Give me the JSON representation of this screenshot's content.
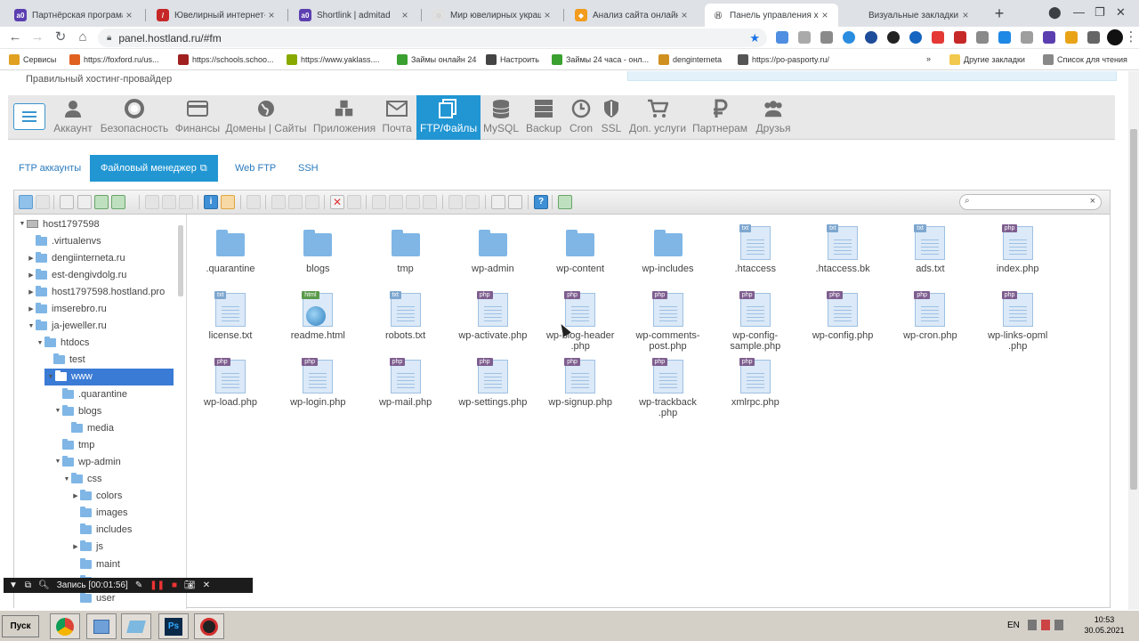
{
  "browser": {
    "tabs": [
      {
        "title": "Партнёрская програма Л",
        "fav_color": "#5b3fb0",
        "fav_text": "a0"
      },
      {
        "title": "Ювелирный интернет-ма",
        "fav_color": "#c62828",
        "fav_text": "/"
      },
      {
        "title": "Shortlink | admitad",
        "fav_color": "#5b3fb0",
        "fav_text": "a0"
      },
      {
        "title": "Мир ювелирных украшен",
        "fav_color": "#e0e0e0",
        "fav_text": "◌"
      },
      {
        "title": "Анализ сайта онлайн | SE",
        "fav_color": "#f29b1c",
        "fav_text": "◆"
      },
      {
        "title": "Панель управления хости",
        "fav_color": "#ffffff",
        "fav_text": "Ⓗ"
      },
      {
        "title": "Визуальные закладки",
        "fav_color": "#dee1e6",
        "fav_text": ""
      }
    ],
    "new_tab": "+",
    "url": "panel.hostland.ru/#fm",
    "bookmarks": [
      {
        "label": "Сервисы",
        "color": "#e0a020"
      },
      {
        "label": "https://foxford.ru/us...",
        "color": "#e06020"
      },
      {
        "label": "https://schools.schoo...",
        "color": "#a02020"
      },
      {
        "label": "https://www.yaklass....",
        "color": "#88aa00"
      },
      {
        "label": "Займы онлайн 24",
        "color": "#3aa030"
      },
      {
        "label": "Настроить",
        "color": "#444444"
      },
      {
        "label": "Займы 24 часа - онл...",
        "color": "#3aa030"
      },
      {
        "label": "denginterneta",
        "color": "#d09020"
      },
      {
        "label": "https://po-pasporty.ru/",
        "color": "#555555"
      }
    ],
    "bookmarks_more": "»",
    "other_bookmarks": "Другие закладки",
    "reading_list": "Список для чтения"
  },
  "page": {
    "tagline": "Правильный хостинг-провайдер",
    "nav": [
      {
        "label": "Аккаунт",
        "icon": "person-icon"
      },
      {
        "label": "Безопасность",
        "icon": "lifebuoy-icon"
      },
      {
        "label": "Финансы",
        "icon": "card-icon"
      },
      {
        "label": "Домены | Сайты",
        "icon": "globe-icon"
      },
      {
        "label": "Приложения",
        "icon": "cubes-icon"
      },
      {
        "label": "Почта",
        "icon": "envelope-icon"
      },
      {
        "label": "FTP/Файлы",
        "icon": "files-icon"
      },
      {
        "label": "MySQL",
        "icon": "database-icon"
      },
      {
        "label": "Backup",
        "icon": "server-icon"
      },
      {
        "label": "Cron",
        "icon": "clock-icon"
      },
      {
        "label": "SSL",
        "icon": "shield-icon"
      },
      {
        "label": "Доп. услуги",
        "icon": "cart-icon"
      },
      {
        "label": "Партнерам",
        "icon": "ruble-icon"
      },
      {
        "label": "Друзья",
        "icon": "users-icon"
      }
    ],
    "active_nav": "FTP/Файлы",
    "subtabs": [
      "FTP аккаунты",
      "Файловый менеджер",
      "Web FTP",
      "SSH"
    ],
    "active_subtab": "Файловый менеджер"
  },
  "filemanager": {
    "tree": [
      {
        "label": "host1797598",
        "level": 0,
        "arrow": "▼",
        "type": "drive"
      },
      {
        "label": ".virtualenvs",
        "level": 1,
        "arrow": "",
        "type": "folder"
      },
      {
        "label": "dengiinterneta.ru",
        "level": 1,
        "arrow": "▶",
        "type": "folder"
      },
      {
        "label": "est-dengivdolg.ru",
        "level": 1,
        "arrow": "▶",
        "type": "folder"
      },
      {
        "label": "host1797598.hostland.pro",
        "level": 1,
        "arrow": "▶",
        "type": "folder"
      },
      {
        "label": "imserebro.ru",
        "level": 1,
        "arrow": "▶",
        "type": "folder"
      },
      {
        "label": "ja-jeweller.ru",
        "level": 1,
        "arrow": "▼",
        "type": "folder"
      },
      {
        "label": "htdocs",
        "level": 2,
        "arrow": "▼",
        "type": "folder"
      },
      {
        "label": "test",
        "level": 3,
        "arrow": "",
        "type": "folder"
      },
      {
        "label": "www",
        "level": 3,
        "arrow": "▼",
        "type": "folder",
        "selected": true
      },
      {
        "label": ".quarantine",
        "level": 4,
        "arrow": "",
        "type": "folder"
      },
      {
        "label": "blogs",
        "level": 4,
        "arrow": "▼",
        "type": "folder"
      },
      {
        "label": "media",
        "level": 5,
        "arrow": "",
        "type": "folder"
      },
      {
        "label": "tmp",
        "level": 4,
        "arrow": "",
        "type": "folder"
      },
      {
        "label": "wp-admin",
        "level": 4,
        "arrow": "▼",
        "type": "folder"
      },
      {
        "label": "css",
        "level": 5,
        "arrow": "▼",
        "type": "folder"
      },
      {
        "label": "colors",
        "level": 6,
        "arrow": "▶",
        "type": "folder"
      },
      {
        "label": "images",
        "level": 6,
        "arrow": "",
        "type": "folder"
      },
      {
        "label": "includes",
        "level": 6,
        "arrow": "",
        "type": "folder"
      },
      {
        "label": "js",
        "level": 6,
        "arrow": "▶",
        "type": "folder"
      },
      {
        "label": "maint",
        "level": 6,
        "arrow": "",
        "type": "folder"
      },
      {
        "label": "",
        "level": 6,
        "arrow": "",
        "type": "folder"
      },
      {
        "label": "user",
        "level": 6,
        "arrow": "",
        "type": "folder"
      }
    ],
    "files": [
      {
        "name": ".quarantine",
        "type": "folder"
      },
      {
        "name": "blogs",
        "type": "folder"
      },
      {
        "name": "tmp",
        "type": "folder"
      },
      {
        "name": "wp-admin",
        "type": "folder"
      },
      {
        "name": "wp-content",
        "type": "folder"
      },
      {
        "name": "wp-includes",
        "type": "folder"
      },
      {
        "name": ".htaccess",
        "type": "txt"
      },
      {
        "name": ".htaccess.bk",
        "type": "txt"
      },
      {
        "name": "ads.txt",
        "type": "txt"
      },
      {
        "name": "index.php",
        "type": "php"
      },
      {
        "name": "license.txt",
        "type": "txt"
      },
      {
        "name": "readme.html",
        "type": "html"
      },
      {
        "name": "robots.txt",
        "type": "txt"
      },
      {
        "name": "wp-activate.php",
        "type": "php"
      },
      {
        "name": "wp-blog-header.php",
        "type": "php"
      },
      {
        "name": "wp-comments-post.php",
        "type": "php"
      },
      {
        "name": "wp-config-sample.php",
        "type": "php"
      },
      {
        "name": "wp-config.php",
        "type": "php"
      },
      {
        "name": "wp-cron.php",
        "type": "php"
      },
      {
        "name": "wp-links-opml.php",
        "type": "php"
      },
      {
        "name": "wp-load.php",
        "type": "php"
      },
      {
        "name": "wp-login.php",
        "type": "php"
      },
      {
        "name": "wp-mail.php",
        "type": "php"
      },
      {
        "name": "wp-settings.php",
        "type": "php"
      },
      {
        "name": "wp-signup.php",
        "type": "php"
      },
      {
        "name": "wp-trackback.php",
        "type": "php"
      },
      {
        "name": "xmlrpc.php",
        "type": "php"
      }
    ],
    "search_icon": "⌕",
    "search_clear": "×"
  },
  "recording": {
    "label": "Запись [00:01:56]"
  },
  "taskbar": {
    "start": "Пуск",
    "lang": "EN",
    "time": "10:53",
    "date": "30.05.2021"
  }
}
